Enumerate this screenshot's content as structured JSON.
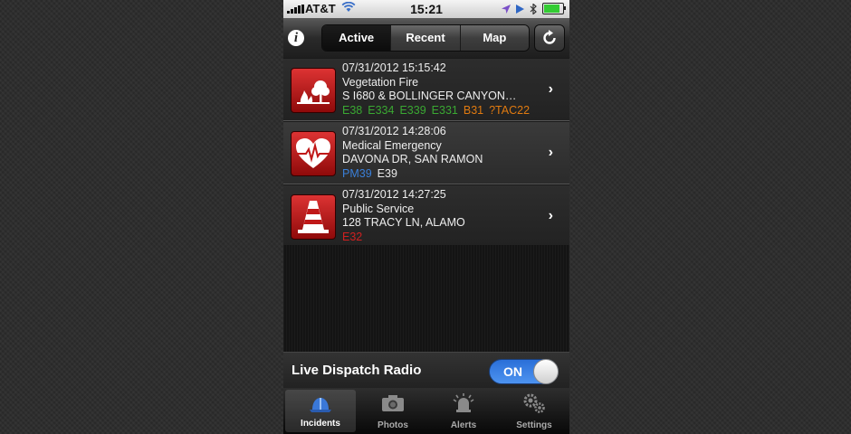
{
  "status_bar": {
    "carrier": "AT&T",
    "time": "15:21"
  },
  "toolbar": {
    "segments": [
      "Active",
      "Recent",
      "Map"
    ],
    "selected_segment": "Active"
  },
  "incidents": [
    {
      "datetime": "07/31/2012 15:15:42",
      "type": "Vegetation Fire",
      "location": "S I680 & BOLLINGER CANYON…",
      "icon": "vegetation-fire-icon",
      "units": [
        {
          "name": "E38",
          "color": "#3aa832"
        },
        {
          "name": "E334",
          "color": "#3aa832"
        },
        {
          "name": "E339",
          "color": "#3aa832"
        },
        {
          "name": "E331",
          "color": "#3aa832"
        },
        {
          "name": "B31",
          "color": "#e07a10"
        },
        {
          "name": "?TAC22",
          "color": "#e07a10"
        }
      ]
    },
    {
      "datetime": "07/31/2012 14:28:06",
      "type": "Medical Emergency",
      "location": "DAVONA DR, SAN RAMON",
      "icon": "heart-pulse-icon",
      "units": [
        {
          "name": "PM39",
          "color": "#3a7fd8"
        },
        {
          "name": "E39",
          "color": "#e8e8e8"
        }
      ]
    },
    {
      "datetime": "07/31/2012 14:27:25",
      "type": "Public Service",
      "location": "128 TRACY LN, ALAMO",
      "icon": "traffic-cone-icon",
      "units": [
        {
          "name": "E32",
          "color": "#d02020"
        }
      ]
    }
  ],
  "radio": {
    "label": "Live Dispatch Radio",
    "state": "ON"
  },
  "tabs": [
    {
      "label": "Incidents",
      "icon": "fire-helmet-icon",
      "selected": true
    },
    {
      "label": "Photos",
      "icon": "camera-icon",
      "selected": false
    },
    {
      "label": "Alerts",
      "icon": "siren-icon",
      "selected": false
    },
    {
      "label": "Settings",
      "icon": "gears-icon",
      "selected": false
    }
  ]
}
